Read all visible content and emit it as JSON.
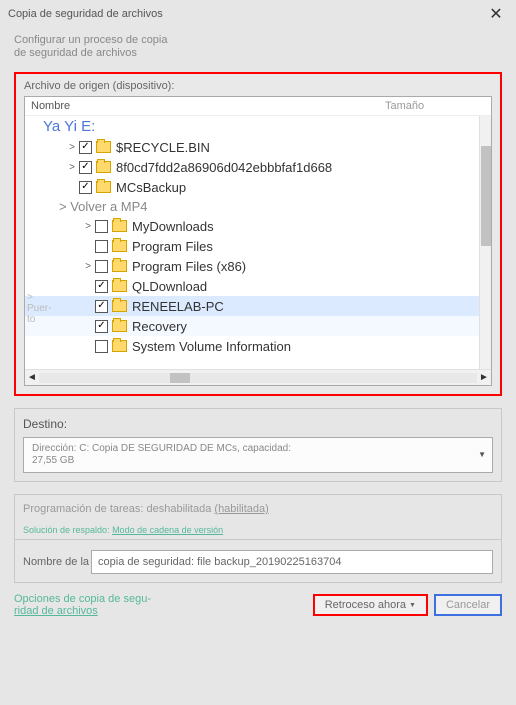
{
  "window": {
    "title": "Copia de seguridad de archivos"
  },
  "subtitle": "Configurar un proceso de copia\nde seguridad de archivos",
  "source_panel": {
    "label": "Archivo de origen (dispositivo):",
    "columns": {
      "name": "Nombre",
      "size": "Tamaño"
    },
    "side_label": "> Puer-\nto",
    "drive": "Ya Yi E:",
    "group": "> Volver a MP4",
    "items_top": [
      {
        "name": "$RECYCLE.BIN",
        "checked": true,
        "expander": true
      },
      {
        "name": "8f0cd7fdd2a86906d042ebbbfaf1d668",
        "checked": true,
        "expander": true
      },
      {
        "name": "MCsBackup",
        "checked": true,
        "expander": false
      }
    ],
    "items_bottom": [
      {
        "name": "MyDownloads",
        "checked": false,
        "expander": true,
        "sel": false
      },
      {
        "name": "Program Files",
        "checked": false,
        "expander": false,
        "sel": false
      },
      {
        "name": "Program Files (x86)",
        "checked": false,
        "expander": true,
        "sel": false
      },
      {
        "name": "QLDownload",
        "checked": true,
        "expander": false,
        "sel": false
      },
      {
        "name": "RENEELAB-PC",
        "checked": true,
        "expander": false,
        "sel": true
      },
      {
        "name": "Recovery",
        "checked": true,
        "expander": false,
        "sel": "sub"
      },
      {
        "name": "System Volume Information",
        "checked": false,
        "expander": false,
        "sel": false
      }
    ]
  },
  "destination": {
    "label": "Destino:",
    "value": "Dirección: C: Copia DE SEGURIDAD DE MCs, capacidad:\n27,55 GB"
  },
  "schedule": {
    "text": "Programación de tareas: deshabilitada ",
    "link": "(habilitada)"
  },
  "solution": {
    "text": "Solución de respaldo: ",
    "link": "Modo de cadena de versión"
  },
  "backup_name": {
    "label_prefix": "Nombre de la ",
    "value": "copia de seguridad: file backup_20190225163704"
  },
  "options_link": {
    "l1": "Opciones de copia de segu-",
    "l2": "ridad de archivos"
  },
  "buttons": {
    "back": "Retroceso ahora",
    "cancel": "Cancelar"
  }
}
